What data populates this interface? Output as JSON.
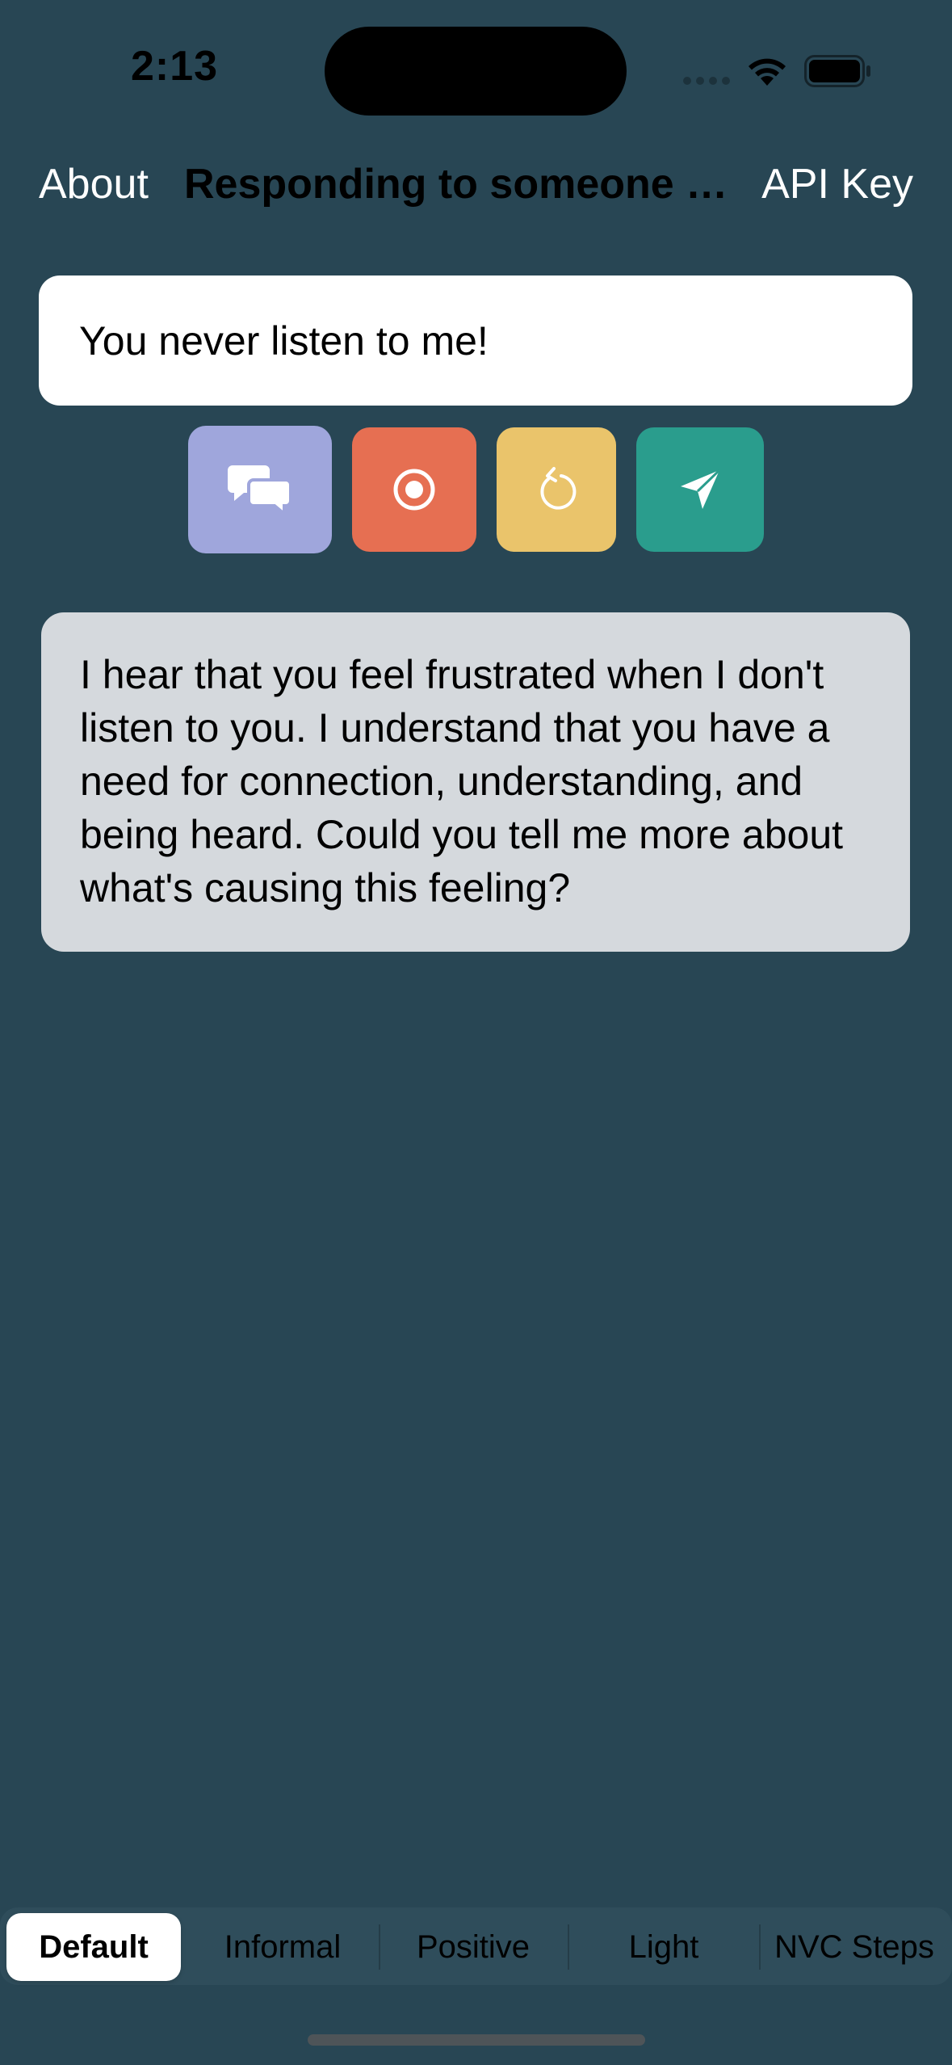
{
  "status_bar": {
    "time": "2:13"
  },
  "nav": {
    "left_label": "About",
    "title": "Responding to someone el...",
    "right_label": "API Key"
  },
  "input": {
    "value": "You never listen to me!"
  },
  "actions": [
    {
      "name": "conversation",
      "icon": "speech-bubbles-icon",
      "color": "#9fa6dc"
    },
    {
      "name": "record",
      "icon": "record-icon",
      "color": "#e66f52"
    },
    {
      "name": "reset",
      "icon": "reset-icon",
      "color": "#eac46b"
    },
    {
      "name": "send",
      "icon": "send-icon",
      "color": "#2a9d8d"
    }
  ],
  "response": {
    "text": "I hear that you feel frustrated when I don't listen to you. I understand that you have a need for connection, understanding, and being heard. Could you tell me more about what's causing this feeling?"
  },
  "modes": {
    "selected": "Default",
    "items": [
      "Default",
      "Informal",
      "Positive",
      "Light",
      "NVC Steps"
    ]
  },
  "colors": {
    "background": "#284654",
    "response_bubble": "#d5d9dd"
  }
}
